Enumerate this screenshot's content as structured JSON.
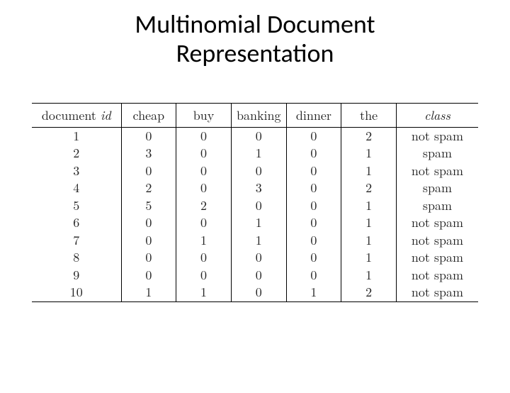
{
  "title_line1": "Multinomial Document",
  "title_line2": "Representation",
  "chart_data": {
    "type": "table",
    "title": "Multinomial Document Representation",
    "headers": [
      "document id",
      "cheap",
      "buy",
      "banking",
      "dinner",
      "the",
      "class"
    ],
    "rows": [
      {
        "id": "1",
        "cheap": "0",
        "buy": "0",
        "banking": "0",
        "dinner": "0",
        "the": "2",
        "class": "not spam"
      },
      {
        "id": "2",
        "cheap": "3",
        "buy": "0",
        "banking": "1",
        "dinner": "0",
        "the": "1",
        "class": "spam"
      },
      {
        "id": "3",
        "cheap": "0",
        "buy": "0",
        "banking": "0",
        "dinner": "0",
        "the": "1",
        "class": "not spam"
      },
      {
        "id": "4",
        "cheap": "2",
        "buy": "0",
        "banking": "3",
        "dinner": "0",
        "the": "2",
        "class": "spam"
      },
      {
        "id": "5",
        "cheap": "5",
        "buy": "2",
        "banking": "0",
        "dinner": "0",
        "the": "1",
        "class": "spam"
      },
      {
        "id": "6",
        "cheap": "0",
        "buy": "0",
        "banking": "1",
        "dinner": "0",
        "the": "1",
        "class": "not spam"
      },
      {
        "id": "7",
        "cheap": "0",
        "buy": "1",
        "banking": "1",
        "dinner": "0",
        "the": "1",
        "class": "not spam"
      },
      {
        "id": "8",
        "cheap": "0",
        "buy": "0",
        "banking": "0",
        "dinner": "0",
        "the": "1",
        "class": "not spam"
      },
      {
        "id": "9",
        "cheap": "0",
        "buy": "0",
        "banking": "0",
        "dinner": "0",
        "the": "1",
        "class": "not spam"
      },
      {
        "id": "10",
        "cheap": "1",
        "buy": "1",
        "banking": "0",
        "dinner": "1",
        "the": "2",
        "class": "not spam"
      }
    ]
  }
}
